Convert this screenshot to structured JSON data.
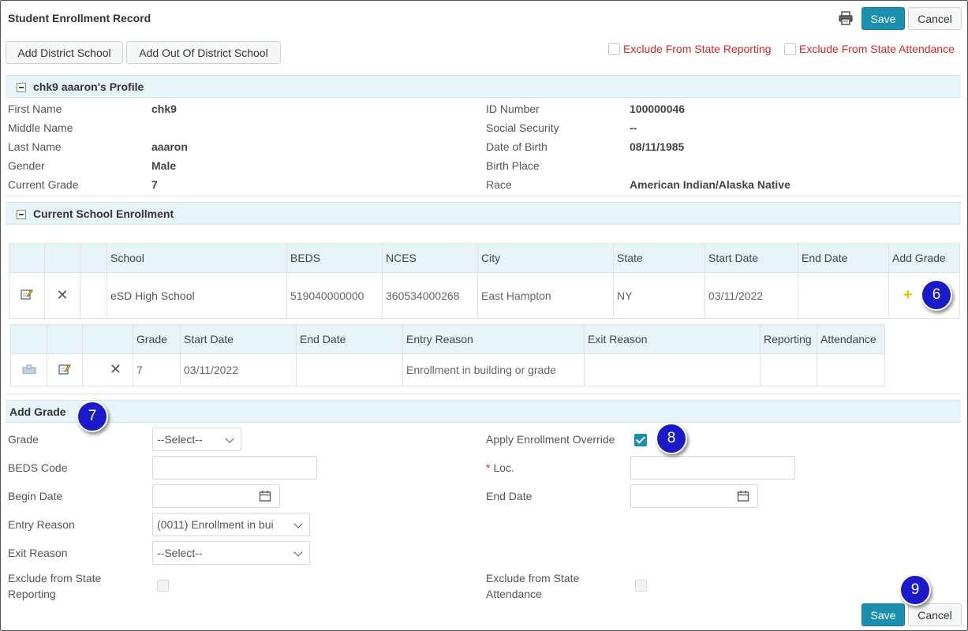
{
  "page": {
    "title": "Student Enrollment Record",
    "save_label": "Save",
    "cancel_label": "Cancel",
    "print_icon": "printer-icon"
  },
  "toolbar": {
    "add_district_school": "Add District School",
    "add_out_of_district_school": "Add Out Of District School",
    "exclude_state_reporting": "Exclude From State Reporting",
    "exclude_state_attendance": "Exclude From State Attendance"
  },
  "profile": {
    "header": "chk9 aaaron's Profile",
    "left": [
      {
        "label": "First Name",
        "value": "chk9"
      },
      {
        "label": "Middle Name",
        "value": ""
      },
      {
        "label": "Last Name",
        "value": "aaaron"
      },
      {
        "label": "Gender",
        "value": "Male"
      },
      {
        "label": "Current Grade",
        "value": "7"
      }
    ],
    "right": [
      {
        "label": "ID Number",
        "value": "100000046"
      },
      {
        "label": "Social Security",
        "value": "--"
      },
      {
        "label": "Date of Birth",
        "value": "08/11/1985"
      },
      {
        "label": "Birth Place",
        "value": ""
      },
      {
        "label": "Race",
        "value": "American Indian/Alaska Native"
      }
    ]
  },
  "enrollment": {
    "header": "Current School Enrollment",
    "columns": [
      "School",
      "BEDS",
      "NCES",
      "City",
      "State",
      "Start Date",
      "End Date",
      "Add Grade"
    ],
    "row": {
      "school": "eSD High School",
      "beds": "519040000000",
      "nces": "360534000268",
      "city": "East Hampton",
      "state": "NY",
      "start_date": "03/11/2022",
      "end_date": ""
    },
    "grade_columns": [
      "Grade",
      "Start Date",
      "End Date",
      "Entry Reason",
      "Exit Reason",
      "Reporting",
      "Attendance"
    ],
    "grade_row": {
      "grade": "7",
      "start_date": "03/11/2022",
      "end_date": "",
      "entry_reason": "Enrollment in building or grade",
      "exit_reason": "",
      "reporting": "",
      "attendance": ""
    }
  },
  "add_grade": {
    "header": "Add Grade",
    "grade_label": "Grade",
    "grade_value": "--Select--",
    "beds_label": "BEDS Code",
    "beds_value": "",
    "begin_label": "Begin Date",
    "begin_value": "",
    "entry_label": "Entry Reason",
    "entry_value": "(0011) Enrollment in bui",
    "exit_label": "Exit Reason",
    "exit_value": "--Select--",
    "excl_rep_label_1": "Exclude from State",
    "excl_rep_label_2": "Reporting",
    "override_label": "Apply Enrollment Override",
    "override_checked": true,
    "loc_required": "*",
    "loc_label": "Loc.",
    "loc_value": "",
    "end_label": "End Date",
    "end_value": "",
    "excl_att_label_1": "Exclude from State",
    "excl_att_label_2": "Attendance"
  },
  "callouts": [
    "6",
    "7",
    "8",
    "9"
  ],
  "colors": {
    "primary": "#1a8fae",
    "callout": "#1a1ac8",
    "section": "#e7f4f7",
    "warning_text": "#d7262a"
  }
}
